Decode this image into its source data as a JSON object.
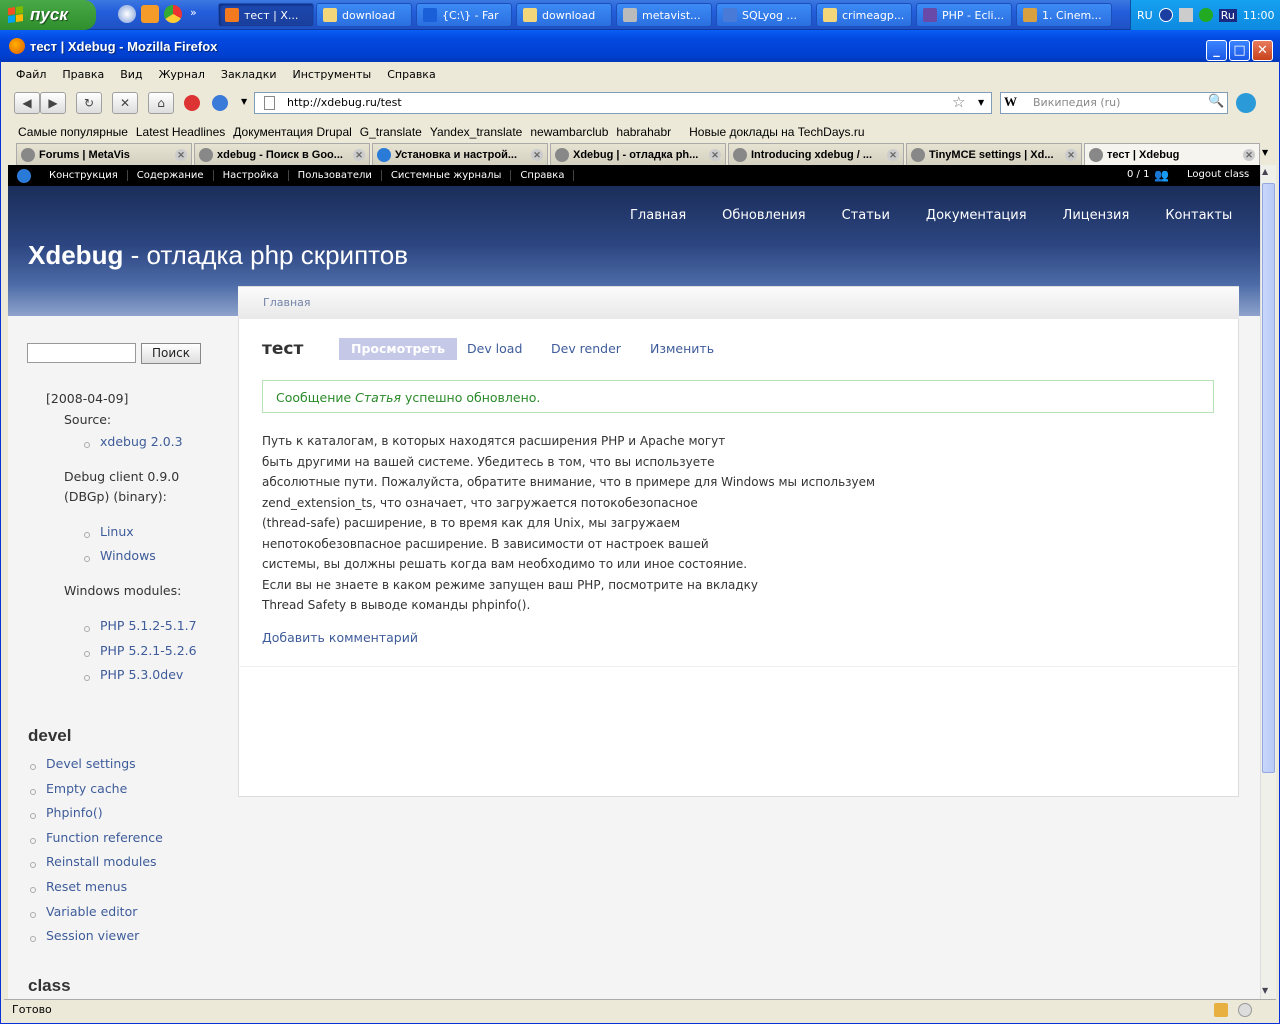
{
  "taskbar": {
    "start_label": "пуск",
    "tasks": [
      "тест | X...",
      "download",
      "{C:\\} - Far",
      "download",
      "metavist...",
      "SQLyog ...",
      "crimeagp...",
      "PHP - Ecli...",
      "1. Cinem..."
    ],
    "tray_lang": "RU",
    "tray_lang2": "Ru",
    "clock": "11:00"
  },
  "window": {
    "title": "тест | Xdebug - Mozilla Firefox",
    "minimize": "_",
    "maximize": "□",
    "close": "✕"
  },
  "menu": [
    "Файл",
    "Правка",
    "Вид",
    "Журнал",
    "Закладки",
    "Инструменты",
    "Справка"
  ],
  "navigation": {
    "url": "http://xdebug.ru/test",
    "search_placeholder": "Википедия (ru)",
    "search_engine_letter": "W"
  },
  "bookmarks": [
    "Самые популярные",
    "Latest Headlines",
    "Документация Drupal",
    "G_translate",
    "Yandex_translate",
    "newambarclub",
    "habrahabr",
    "Новые доклады на TechDays.ru"
  ],
  "tabs": [
    {
      "label": "Forums | MetaVis",
      "active": false
    },
    {
      "label": "xdebug - Поиск в Goo...",
      "active": false
    },
    {
      "label": "Установка и настрой...",
      "active": false
    },
    {
      "label": "Xdebug | - отладка ph...",
      "active": false
    },
    {
      "label": "Introducing xdebug / ...",
      "active": false
    },
    {
      "label": "TinyMCE settings | Xd...",
      "active": false
    },
    {
      "label": "тест | Xdebug",
      "active": true
    }
  ],
  "adminbar": {
    "items": [
      "Конструкция",
      "Содержание",
      "Настройка",
      "Пользователи",
      "Системные журналы",
      "Справка"
    ],
    "users_count": "0 / 1",
    "logout": "Logout class"
  },
  "site": {
    "name_bold": "Xdebug",
    "name_rest": " - отладка php скриптов",
    "primary_links": [
      "Главная",
      "Обновления",
      "Статьи",
      "Документация",
      "Лицензия",
      "Контакты"
    ]
  },
  "sidebar": {
    "search_button": "Поиск",
    "date": "[2008-04-09]",
    "source_label": "Source:",
    "source_link": "xdebug 2.0.3",
    "debug_client_line1": "Debug client 0.9.0",
    "debug_client_line2": "(DBGp) (binary):",
    "os_links": [
      "Linux",
      "Windows"
    ],
    "modules_label": "Windows modules:",
    "module_links": [
      "PHP 5.1.2-5.1.7",
      "PHP 5.2.1-5.2.6",
      "PHP 5.3.0dev"
    ],
    "devel_title": "devel",
    "devel_links": [
      "Devel settings",
      "Empty cache",
      "Phpinfo()",
      "Function reference",
      "Reinstall modules",
      "Reset menus",
      "Variable editor",
      "Session viewer"
    ],
    "class_title": "class"
  },
  "page": {
    "breadcrumb": "Главная",
    "title": "тест",
    "local_tabs": [
      {
        "label": "Просмотреть",
        "active": true
      },
      {
        "label": "Dev load",
        "active": false
      },
      {
        "label": "Dev render",
        "active": false
      },
      {
        "label": "Изменить",
        "active": false
      }
    ],
    "message_prefix": "Сообщение ",
    "message_em": "Статья",
    "message_suffix": " успешно обновлено.",
    "body_lines": [
      "Путь к каталогам, в которых находятся расширения PHP и Apache могут",
      "быть другими на вашей системе. Убедитесь в том, что вы используете",
      "абсолютные пути. Пожалуйста, обратите внимание, что в примере для Windows мы используем",
      "zend_extension_ts, что означает, что загружается потокобезопасное",
      "(thread-safe) расширение, в то время как для Unix, мы загружаем",
      "непотокобезовпасное расширение. В зависимости от настроек вашей",
      "системы, вы должны решать когда вам необходимо то или иное состояние.",
      "Если вы не знаете в каком режиме запущен ваш PHP, посмотрите на вкладку",
      "Thread Safety в выводе команды phpinfo()."
    ],
    "add_comment": "Добавить комментарий"
  },
  "status": {
    "text": "Готово"
  },
  "colors": {
    "accent": "#3e5c9a",
    "header": "#2c4580",
    "message": "#2a8a2a"
  }
}
